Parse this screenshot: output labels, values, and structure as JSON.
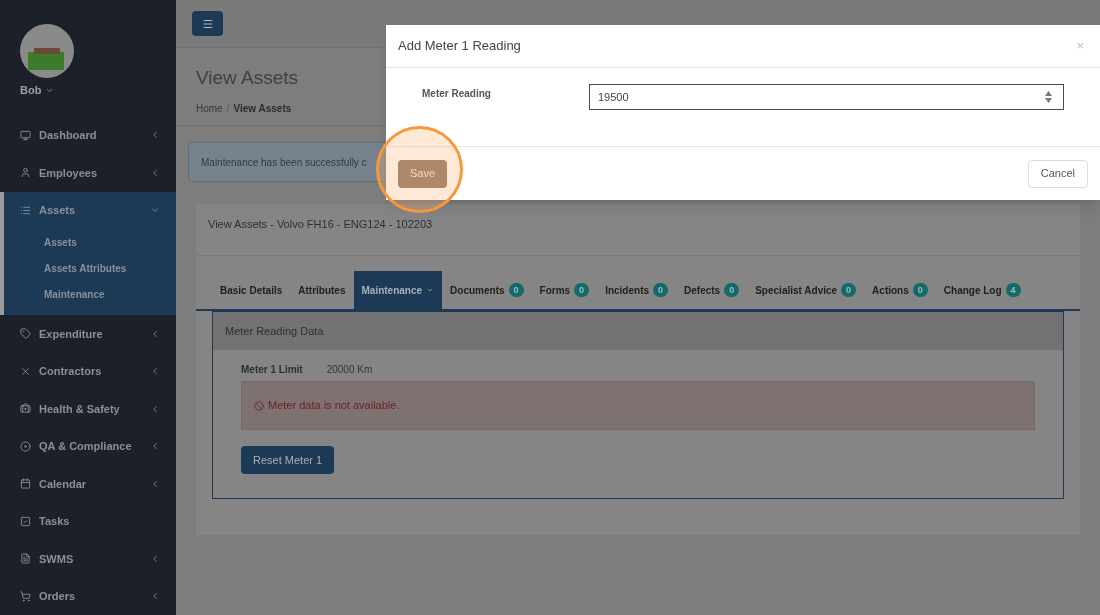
{
  "user": {
    "name": "Bob"
  },
  "sidebar": {
    "items": [
      {
        "label": "Dashboard",
        "expanded": false,
        "has_caret": true
      },
      {
        "label": "Employees",
        "expanded": false,
        "has_caret": true
      },
      {
        "label": "Assets",
        "expanded": true,
        "has_caret": true,
        "children": [
          {
            "label": "Assets"
          },
          {
            "label": "Assets Attributes"
          },
          {
            "label": "Maintenance"
          }
        ]
      },
      {
        "label": "Expenditure",
        "expanded": false,
        "has_caret": true
      },
      {
        "label": "Contractors",
        "expanded": false,
        "has_caret": true
      },
      {
        "label": "Health & Safety",
        "expanded": false,
        "has_caret": true
      },
      {
        "label": "QA & Compliance",
        "expanded": false,
        "has_caret": true
      },
      {
        "label": "Calendar",
        "expanded": false,
        "has_caret": true
      },
      {
        "label": "Tasks",
        "expanded": false,
        "has_caret": false
      },
      {
        "label": "SWMS",
        "expanded": false,
        "has_caret": true
      },
      {
        "label": "Orders",
        "expanded": false,
        "has_caret": true
      }
    ]
  },
  "page": {
    "title": "View Assets",
    "breadcrumb_separator": "/",
    "breadcrumb": [
      {
        "label": "Home",
        "current": false
      },
      {
        "label": "View Assets",
        "current": true
      }
    ]
  },
  "alert": {
    "text": "Maintenance has been successfully c"
  },
  "card": {
    "title": "View Assets - Volvo FH16 - ENG124 - 102203",
    "tabs": [
      {
        "label": "Basic Details",
        "selected": false
      },
      {
        "label": "Attributes",
        "selected": false
      },
      {
        "label": "Maintenance",
        "selected": true,
        "dropdown": true
      },
      {
        "label": "Documents",
        "selected": false,
        "count": "0"
      },
      {
        "label": "Forms",
        "selected": false,
        "count": "0"
      },
      {
        "label": "Incidents",
        "selected": false,
        "count": "0"
      },
      {
        "label": "Defects",
        "selected": false,
        "count": "0"
      },
      {
        "label": "Specialist Advice",
        "selected": false,
        "count": "0"
      },
      {
        "label": "Actions",
        "selected": false,
        "count": "0"
      },
      {
        "label": "Change Log",
        "selected": false,
        "count": "4"
      }
    ],
    "panel": {
      "title": "Meter Reading Data",
      "limit_label": "Meter 1 Limit",
      "limit_value": "20000 Km",
      "error": "Meter data is not available.",
      "reset_button": "Reset Meter 1"
    }
  },
  "modal": {
    "title": "Add Meter 1 Reading",
    "close": "×",
    "field_label": "Meter Reading",
    "value": "19500",
    "save": "Save",
    "cancel": "Cancel"
  }
}
